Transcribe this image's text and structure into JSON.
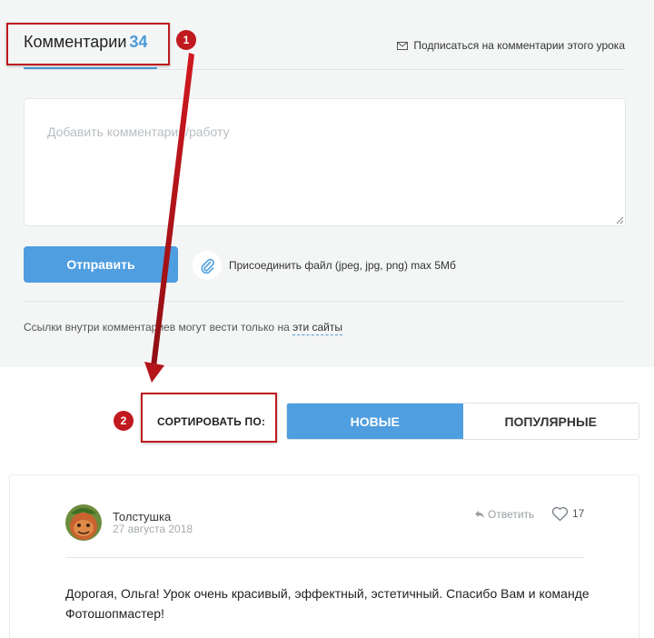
{
  "comments": {
    "title": "Комментарии",
    "count": "34",
    "subscribe_label": "Подписаться на комментарии этого урока",
    "input_placeholder": "Добавить комментарий/работу",
    "send_label": "Отправить",
    "attach_label": "Присоединить файл (jpeg, jpg, png) max 5Мб",
    "links_note_prefix": "Ссылки внутри комментариев могут вести только на",
    "links_note_link": "эти сайты"
  },
  "annotations": {
    "badge_1": "1",
    "badge_2": "2"
  },
  "sort": {
    "label": "СОРТИРОВАТЬ ПО:",
    "options": [
      "НОВЫЕ",
      "ПОПУЛЯРНЫЕ"
    ],
    "active": "НОВЫЕ"
  },
  "comment": {
    "author": "Толстушка",
    "date": "27 августа 2018",
    "reply_label": "Ответить",
    "likes": "17",
    "text": "Дорогая, Ольга! Урок очень красивый, эффектный, эстетичный. Спасибо Вам и команде Фотошопмастер!"
  },
  "colors": {
    "accent": "#4f9ee0",
    "annotation": "#c0191f",
    "panel_bg": "#f4f6f6"
  }
}
